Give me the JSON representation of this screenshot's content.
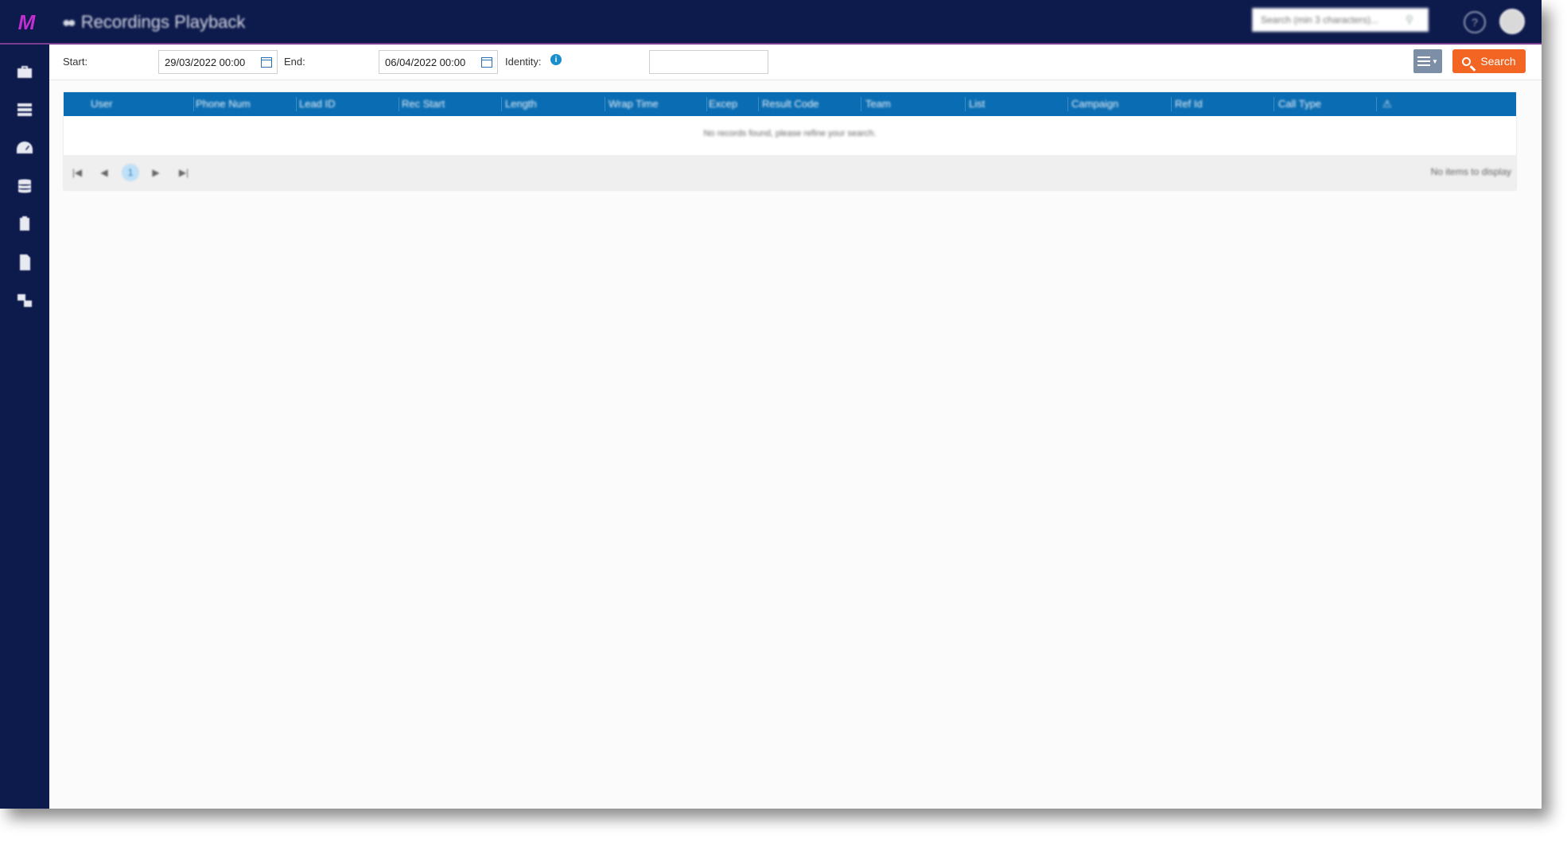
{
  "app": {
    "logo_text": "M",
    "page_title": "Recordings Playback",
    "global_search_placeholder": "Search (min 3 characters)..."
  },
  "sidebar": {
    "items": [
      {
        "name": "briefcase-icon"
      },
      {
        "name": "list-icon"
      },
      {
        "name": "dashboard-icon"
      },
      {
        "name": "database-icon"
      },
      {
        "name": "contacts-icon"
      },
      {
        "name": "document-icon"
      },
      {
        "name": "settings-icon"
      }
    ]
  },
  "filters": {
    "start_label": "Start:",
    "start_value": "29/03/2022 00:00",
    "end_label": "End:",
    "end_value": "06/04/2022 00:00",
    "identity_label": "Identity:",
    "identity_value": "",
    "search_label": "Search"
  },
  "grid": {
    "columns": [
      "User",
      "Phone Num",
      "Lead ID",
      "Rec Start",
      "Length",
      "Wrap Time",
      "Excep",
      "Result Code",
      "Team",
      "List",
      "Campaign",
      "Ref Id",
      "Call Type",
      "⚠"
    ],
    "empty_message": "No records found, please refine your search.",
    "pager": {
      "current_page": "1",
      "info": "No items to display"
    }
  },
  "colors": {
    "topbar": "#0d1a4c",
    "grid_header": "#0a6db3",
    "search_button": "#f26522",
    "columns_button": "#7d8fa6"
  }
}
